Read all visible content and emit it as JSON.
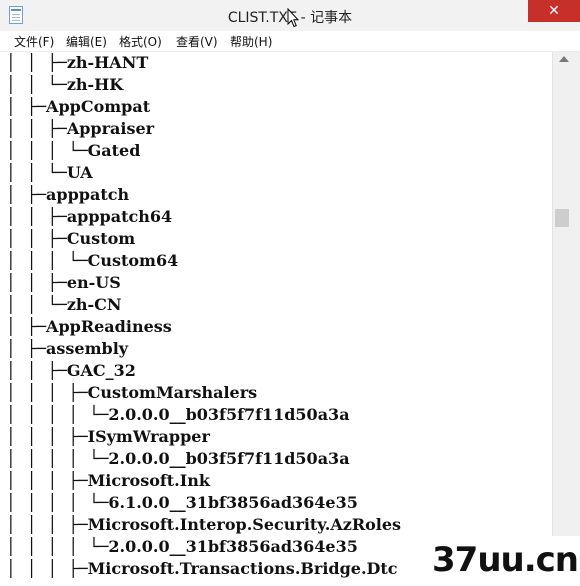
{
  "window": {
    "title": "CLIST.TXT - 记事本",
    "close_label": "✕",
    "icon": "notepad-icon"
  },
  "menu": [
    {
      "label": "文件(F)"
    },
    {
      "label": "编辑(E)"
    },
    {
      "label": "格式(O)"
    },
    {
      "label": "查看(V)"
    },
    {
      "label": "帮助(H)"
    }
  ],
  "document": {
    "lines": [
      "│  │  ├─zh-HANT",
      "│  │  └─zh-HK",
      "│  ├─AppCompat",
      "│  │  ├─Appraiser",
      "│  │  │  └─Gated",
      "│  │  └─UA",
      "│  ├─apppatch",
      "│  │  ├─apppatch64",
      "│  │  ├─Custom",
      "│  │  │  └─Custom64",
      "│  │  ├─en-US",
      "│  │  └─zh-CN",
      "│  ├─AppReadiness",
      "│  ├─assembly",
      "│  │  ├─GAC_32",
      "│  │  │  ├─CustomMarshalers",
      "│  │  │  │  └─2.0.0.0__b03f5f7f11d50a3a",
      "│  │  │  ├─ISymWrapper",
      "│  │  │  │  └─2.0.0.0__b03f5f7f11d50a3a",
      "│  │  │  ├─Microsoft.Ink",
      "│  │  │  │  └─6.1.0.0__31bf3856ad364e35",
      "│  │  │  ├─Microsoft.Interop.Security.AzRoles",
      "│  │  │  │  └─2.0.0.0__31bf3856ad364e35",
      "│  │  │  ├─Microsoft.Transactions.Bridge.Dtc"
    ]
  },
  "watermark": {
    "text": "37uu.cn"
  },
  "colors": {
    "close_button": "#c7302a",
    "titlebar": "#f2f2f2",
    "text": "#111111"
  }
}
